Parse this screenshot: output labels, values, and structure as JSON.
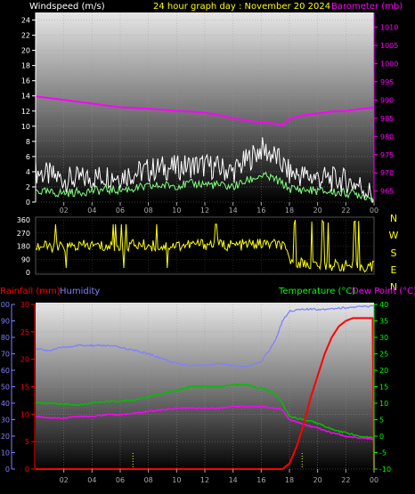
{
  "header": {
    "windspeed_label": "Windspeed (m/s)",
    "title": "24 hour graph day : November 20 2024",
    "barometer_label": "Barometer (mb)"
  },
  "lower_header": {
    "rainfall_label": "Rainfall (mm)",
    "humidity_label": "Humidity",
    "temperature_label": "Temperature (°C)",
    "dewpoint_label": "Dew Point (°C)"
  },
  "colors": {
    "wind_gust": "#ffffff",
    "wind_avg": "#80ff80",
    "barometer": "#ff00ff",
    "direction": "#ffff00",
    "rain": "#ff0000",
    "humidity": "#8080ff",
    "temperature": "#00c000",
    "dewpoint": "#ff00ff"
  },
  "chart_data": [
    {
      "type": "line",
      "x_ticks": [
        "02",
        "04",
        "06",
        "08",
        "10",
        "12",
        "14",
        "16",
        "18",
        "20",
        "22",
        "00"
      ],
      "left_axis": {
        "ticks": [
          "0",
          "2",
          "4",
          "6",
          "8",
          "10",
          "12",
          "14",
          "16",
          "18",
          "20",
          "22",
          "24"
        ],
        "ylim": [
          0,
          25
        ]
      },
      "right_axis": {
        "ticks": [
          "965",
          "970",
          "975",
          "980",
          "985",
          "990",
          "995",
          "1000",
          "1005",
          "1010"
        ],
        "ylim": [
          962,
          1014
        ]
      },
      "series": [
        {
          "name": "Windspeed",
          "axis": "left",
          "x": [
            0,
            1,
            2,
            3,
            4,
            5,
            6,
            7,
            8,
            9,
            10,
            11,
            12,
            13,
            14,
            15,
            16,
            17,
            18,
            19,
            20,
            21,
            22,
            23,
            24
          ],
          "gust": [
            4.0,
            3.5,
            3.0,
            3.0,
            3.2,
            3.5,
            3.5,
            3.8,
            4.2,
            4.5,
            4.5,
            4.8,
            4.8,
            4.5,
            4.0,
            5.5,
            7.0,
            6.0,
            3.8,
            3.5,
            3.2,
            3.0,
            2.8,
            2.2,
            0.8
          ],
          "avg": [
            1.5,
            1.2,
            1.2,
            1.3,
            1.5,
            1.6,
            1.6,
            1.8,
            2.0,
            2.2,
            2.2,
            2.4,
            2.4,
            2.2,
            2.0,
            2.8,
            3.5,
            3.0,
            1.8,
            1.6,
            1.5,
            1.3,
            1.2,
            1.0,
            0.4
          ]
        },
        {
          "name": "Barometer",
          "axis": "right",
          "x": [
            0,
            1,
            2,
            3,
            4,
            5,
            6,
            7,
            8,
            9,
            10,
            11,
            12,
            13,
            14,
            15,
            16,
            17,
            17.5,
            18,
            19,
            20,
            21,
            22,
            23,
            24
          ],
          "values": [
            991,
            990.5,
            990,
            989.5,
            989,
            988.5,
            988,
            987.8,
            987.6,
            987.3,
            987,
            986.8,
            986.5,
            985.8,
            985,
            984.3,
            983.8,
            983.5,
            983,
            984.8,
            985.8,
            986.3,
            986.8,
            987,
            987.5,
            988
          ]
        }
      ]
    },
    {
      "type": "line",
      "direction_labels": [
        "N",
        "W",
        "S",
        "E",
        "N"
      ],
      "left_axis": {
        "ticks": [
          "0",
          "90",
          "180",
          "270",
          "360"
        ],
        "ylim": [
          0,
          360
        ]
      },
      "series": [
        {
          "name": "Wind Direction",
          "x": [
            0,
            1,
            2,
            3,
            4,
            5,
            6,
            7,
            8,
            9,
            10,
            11,
            12,
            13,
            14,
            15,
            16,
            17,
            17.5,
            18,
            19,
            20,
            21,
            22,
            23,
            24
          ],
          "values": [
            180,
            175,
            170,
            180,
            185,
            175,
            180,
            190,
            185,
            180,
            185,
            190,
            195,
            190,
            185,
            190,
            195,
            190,
            185,
            90,
            60,
            50,
            50,
            45,
            40,
            40
          ]
        }
      ]
    },
    {
      "type": "line",
      "x_ticks": [
        "02",
        "04",
        "06",
        "08",
        "10",
        "12",
        "14",
        "16",
        "18",
        "20",
        "22",
        "00"
      ],
      "left_axis": {
        "ticks": [
          "0",
          "5",
          "10",
          "15",
          "20",
          "25",
          "30"
        ],
        "ylim": [
          0,
          30
        ]
      },
      "humidity_axis": {
        "ticks": [
          "0",
          "10",
          "20",
          "30",
          "40",
          "50",
          "60",
          "70",
          "80",
          "90",
          "100"
        ],
        "ylim": [
          0,
          100
        ]
      },
      "right_axis": {
        "ticks": [
          "-10",
          "-5",
          "0",
          "5",
          "10",
          "15",
          "20",
          "25",
          "30",
          "35",
          "40"
        ],
        "ylim": [
          -10,
          40
        ]
      },
      "series": [
        {
          "name": "Rainfall",
          "axis": "left",
          "x": [
            0,
            17.5,
            18,
            18.5,
            19,
            19.5,
            20,
            20.5,
            21,
            21.5,
            22,
            22.5,
            23,
            23.9,
            24
          ],
          "values": [
            0,
            0,
            1,
            4,
            8,
            13,
            17,
            21,
            24,
            26,
            27,
            27.5,
            27.5,
            27.5,
            0
          ]
        },
        {
          "name": "Humidity",
          "axis": "humidity",
          "x": [
            0,
            1,
            2,
            3,
            4,
            5,
            6,
            7,
            8,
            9,
            10,
            11,
            12,
            13,
            14,
            15,
            16,
            17,
            17.5,
            18,
            19,
            20,
            21,
            22,
            23,
            24
          ],
          "values": [
            73,
            72,
            74,
            75,
            75,
            75,
            74,
            72,
            70,
            67,
            64,
            63,
            63,
            64,
            63,
            62,
            65,
            78,
            90,
            96,
            97,
            97,
            97.5,
            98,
            98.5,
            99
          ]
        },
        {
          "name": "Temperature",
          "axis": "right",
          "x": [
            0,
            1,
            2,
            3,
            4,
            5,
            6,
            7,
            8,
            9,
            10,
            11,
            12,
            13,
            14,
            15,
            16,
            17,
            17.5,
            18,
            19,
            20,
            21,
            22,
            23,
            24
          ],
          "values": [
            10,
            10,
            9.8,
            9.5,
            10,
            10.5,
            10.5,
            11,
            12,
            13,
            14,
            15,
            15,
            15,
            15.5,
            15.5,
            14.5,
            13,
            10,
            6,
            5,
            4,
            2,
            1,
            0,
            -0.5
          ]
        },
        {
          "name": "Dew Point",
          "axis": "right",
          "x": [
            0,
            1,
            2,
            3,
            4,
            5,
            6,
            7,
            8,
            9,
            10,
            11,
            12,
            13,
            14,
            15,
            16,
            17,
            17.5,
            18,
            19,
            20,
            21,
            22,
            23,
            24
          ],
          "values": [
            6,
            5.5,
            5.5,
            6,
            6,
            6.5,
            6.5,
            7,
            7.5,
            8,
            8.5,
            8.5,
            8.5,
            8.5,
            9,
            9,
            9,
            8.5,
            8,
            5,
            3.5,
            2.5,
            1,
            0,
            -0.5,
            -1
          ]
        }
      ]
    }
  ]
}
